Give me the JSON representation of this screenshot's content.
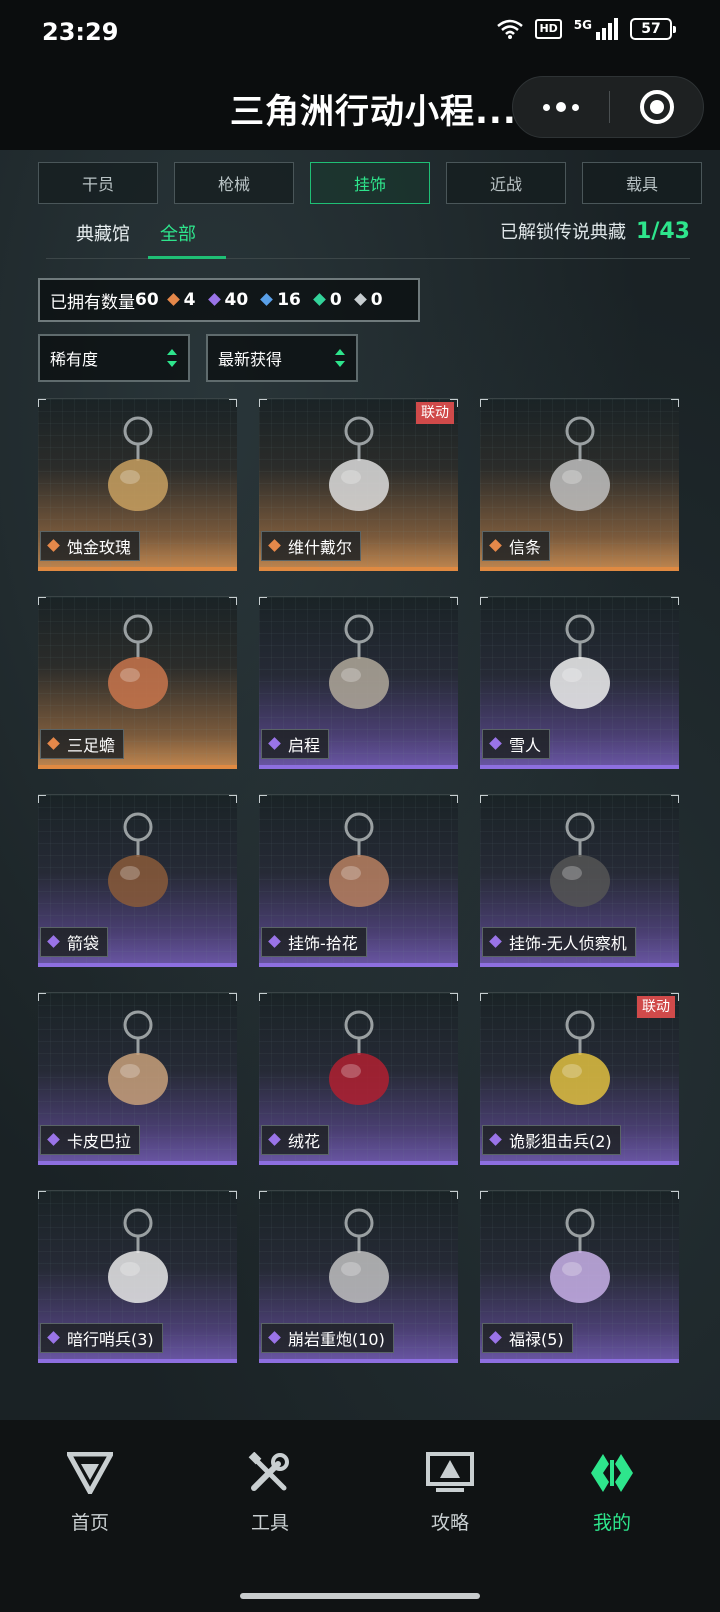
{
  "status_bar": {
    "time": "23:29",
    "network_badge": "HD",
    "network_type": "5G",
    "battery": "57",
    "icons": [
      "wifi-icon",
      "hd-icon",
      "signal-icon",
      "battery-icon"
    ]
  },
  "app": {
    "title": "三角洲行动小程...",
    "more_icon": "more-dots-icon",
    "close_icon": "target-ring-icon"
  },
  "category_tabs": [
    {
      "label": "干员",
      "active": false
    },
    {
      "label": "枪械",
      "active": false
    },
    {
      "label": "挂饰",
      "active": true
    },
    {
      "label": "近战",
      "active": false
    },
    {
      "label": "载具",
      "active": false
    }
  ],
  "sub_tabs": [
    {
      "label": "典藏馆",
      "active": false
    },
    {
      "label": "全部",
      "active": true
    }
  ],
  "legend_unlock": {
    "label": "已解锁传说典藏",
    "value": "1/43"
  },
  "owned": {
    "label": "已拥有数量",
    "total": "60",
    "counts": [
      {
        "rarity": "legend",
        "value": "4",
        "color": "#e5884a"
      },
      {
        "rarity": "epic",
        "value": "40",
        "color": "#9a74e8"
      },
      {
        "rarity": "rare",
        "value": "16",
        "color": "#5aa0e8"
      },
      {
        "rarity": "uncommon",
        "value": "0",
        "color": "#33d39a"
      },
      {
        "rarity": "common",
        "value": "0",
        "color": "#c7cdd0"
      }
    ]
  },
  "filters": {
    "rarity": "稀有度",
    "sort": "最新获得"
  },
  "items": [
    {
      "name": "蚀金玫瑰",
      "rarity": "legend",
      "tag": ""
    },
    {
      "name": "维什戴尔",
      "rarity": "legend",
      "tag": "联动"
    },
    {
      "name": "信条",
      "rarity": "legend",
      "tag": ""
    },
    {
      "name": "三足蟾",
      "rarity": "legend",
      "tag": ""
    },
    {
      "name": "启程",
      "rarity": "epic",
      "tag": ""
    },
    {
      "name": "雪人",
      "rarity": "epic",
      "tag": ""
    },
    {
      "name": "箭袋",
      "rarity": "epic",
      "tag": ""
    },
    {
      "name": "挂饰-拾花",
      "rarity": "epic",
      "tag": ""
    },
    {
      "name": "挂饰-无人侦察机",
      "rarity": "epic",
      "tag": ""
    },
    {
      "name": "卡皮巴拉",
      "rarity": "epic",
      "tag": ""
    },
    {
      "name": "绒花",
      "rarity": "epic",
      "tag": ""
    },
    {
      "name": "诡影狙击兵(2)",
      "rarity": "epic",
      "tag": "联动"
    },
    {
      "name": "暗行哨兵(3)",
      "rarity": "epic",
      "tag": ""
    },
    {
      "name": "崩岩重炮(10)",
      "rarity": "epic",
      "tag": ""
    },
    {
      "name": "福禄(5)",
      "rarity": "epic",
      "tag": ""
    }
  ],
  "bottom_nav": [
    {
      "label": "首页",
      "icon": "home-logo-icon",
      "active": false
    },
    {
      "label": "工具",
      "icon": "tools-icon",
      "active": false
    },
    {
      "label": "攻略",
      "icon": "guide-monitor-icon",
      "active": false
    },
    {
      "label": "我的",
      "icon": "profile-logo-icon",
      "active": true
    }
  ]
}
